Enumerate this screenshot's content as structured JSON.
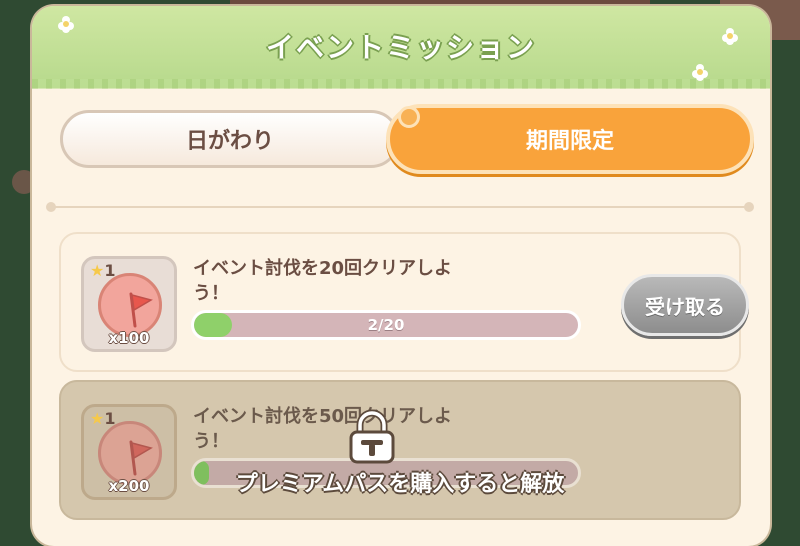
{
  "header": {
    "title": "イベントミッション"
  },
  "tabs": [
    {
      "label": "日がわり",
      "active": false
    },
    {
      "label": "期間限定",
      "active": true
    }
  ],
  "missions": [
    {
      "title": "イベント討伐を20回クリアしよう！",
      "title_line1": "イベント討伐を20回クリアしよ",
      "title_line2": "う！",
      "star_level": "1",
      "reward_qty": "x100",
      "progress_text": "2/20",
      "progress_value": 0.1,
      "button_label": "受け取る",
      "locked": false
    },
    {
      "title": "イベント討伐を50回クリアしよう！",
      "title_line1": "イベント討伐を50回クリアしよ",
      "title_line2": "う！",
      "star_level": "1",
      "reward_qty": "x200",
      "progress_value": 0.04,
      "locked": true
    }
  ],
  "lock_overlay": {
    "text": "プレミアムパスを購入すると解放"
  },
  "colors": {
    "accent": "#f9a33b",
    "panel": "#fdf3e4",
    "header_green": "#b7d98c",
    "progress_fill": "#8fd06a",
    "text_brown": "#6b4e43"
  },
  "icons": {
    "reward": "flag-medal-icon",
    "star": "star-icon",
    "lock": "lock-icon"
  }
}
